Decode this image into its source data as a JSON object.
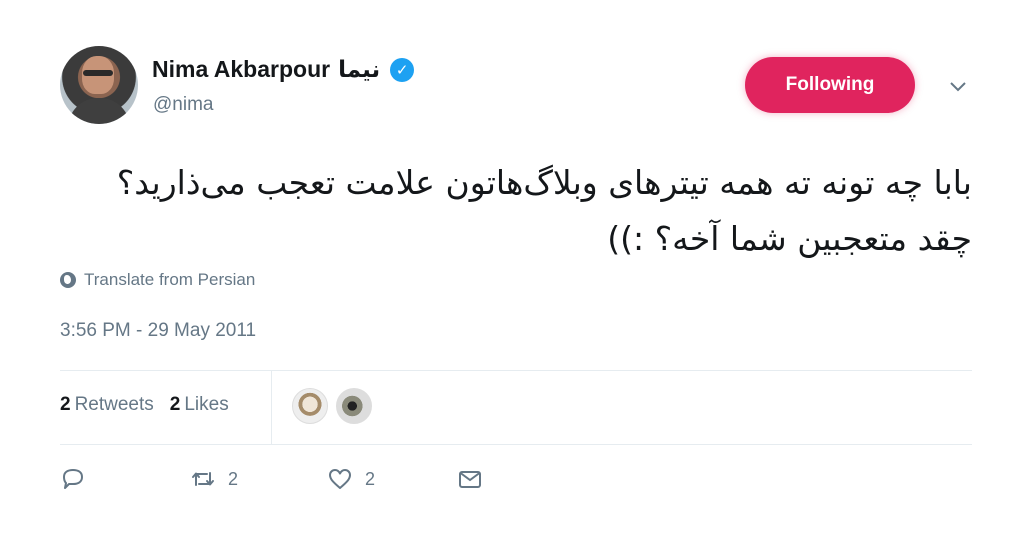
{
  "author": {
    "name": "Nima Akbarpour",
    "name_fa": "نیما",
    "handle": "@nima",
    "verified": true
  },
  "follow_button": {
    "label": "Following",
    "color": "#e0245e"
  },
  "tweet": {
    "text": "بابا چه تونه ته همه تیترهای وبلاگ‌هاتون علامت تعجب می‌ذارید؟ چقد متعجبین شما آخه؟ :))",
    "translate_label": "Translate from Persian",
    "timestamp": "3:56 PM - 29 May 2011"
  },
  "stats": {
    "retweets_count": "2",
    "retweets_label": "Retweets",
    "likes_count": "2",
    "likes_label": "Likes"
  },
  "actions": {
    "retweet_count": "2",
    "like_count": "2"
  },
  "icons": [
    "verified-icon",
    "chevron-down-icon",
    "globe-icon",
    "reply-icon",
    "retweet-icon",
    "heart-icon",
    "message-icon"
  ],
  "colors": {
    "accent": "#1da1f2",
    "secondary_text": "#657786",
    "following": "#e0245e"
  }
}
